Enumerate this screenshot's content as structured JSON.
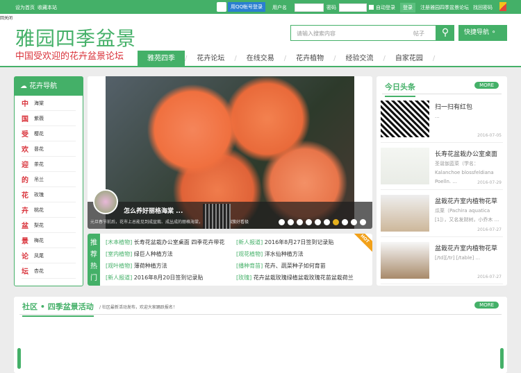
{
  "topbar": {
    "set_home": "设为首页",
    "bookmark": "收藏本站",
    "qq_login": "用QQ帐号登录",
    "username_label": "用户名",
    "password_label": "密码",
    "auto_login": "自动登录",
    "login": "登录",
    "register": "注册雅园四季盆景论坛",
    "forgot": "找回密码"
  },
  "close_label": "回关闭",
  "header": {
    "logo": "雅园四季盆景",
    "slogan": "中国受欢迎的花卉盆景论坛",
    "search_placeholder": "请输入搜索内容",
    "search_type": "帖子",
    "quick_nav": "快捷导航"
  },
  "nav": [
    "雅苑四季",
    "花卉论坛",
    "在线交易",
    "花卉植物",
    "经验交流",
    "自家花园"
  ],
  "flower_nav": {
    "title": "花卉导航",
    "items": [
      {
        "c": "中",
        "n": "海棠"
      },
      {
        "c": "国",
        "n": "紫薇"
      },
      {
        "c": "受",
        "n": "樱花"
      },
      {
        "c": "欢",
        "n": "昙花"
      },
      {
        "c": "迎",
        "n": "茶花"
      },
      {
        "c": "的",
        "n": "吊兰"
      },
      {
        "c": "花",
        "n": "玫瑰"
      },
      {
        "c": "卉",
        "n": "桃花"
      },
      {
        "c": "盆",
        "n": "梨花"
      },
      {
        "c": "景",
        "n": "梅花"
      },
      {
        "c": "论",
        "n": "凤尾"
      },
      {
        "c": "坛",
        "n": "杏花"
      }
    ]
  },
  "slider": {
    "title": "怎么养好丽格海棠 ...",
    "desc": "元旦春节前后，花市上总能见到成盆栽、成丛成的丽格海棠，一盆盆的花团锦簇好看极",
    "active_dot": 6,
    "dot_count": 10
  },
  "recommend": {
    "tag": "推荐热门",
    "items": [
      {
        "cat": "[木本植物]",
        "t": "长寿花盆栽办公室桌面 四季花卉带花"
      },
      {
        "cat": "[新人报道]",
        "t": "2016年8月27日签到记录贴"
      },
      {
        "cat": "[室内植物]",
        "t": "绿巨人种植方法"
      },
      {
        "cat": "[观花植物]",
        "t": "洋水仙种植方法"
      },
      {
        "cat": "[观叶植物]",
        "t": "薄荷种植方法"
      },
      {
        "cat": "[播种育苗]",
        "t": "花卉、蔬菜种子如何育苗"
      },
      {
        "cat": "[新人报道]",
        "t": "2016年8月20日签到记录贴"
      },
      {
        "cat": "[玫瑰]",
        "t": "花卉盆栽玫瑰绿植盆栽玫瑰花苗盆栽荷兰"
      }
    ],
    "hot": "HOT"
  },
  "headlines": {
    "title": "今日头条",
    "more": "MORE",
    "items": [
      {
        "t": "扫一扫有红包",
        "d": "...",
        "date": "2016-07-05"
      },
      {
        "t": "长寿花盆栽办公室桌面",
        "d": "圣诞伽蓝菜（学名：Kalanchoe blossfeldiana Poelln. ...",
        "date": "2016-07-29"
      },
      {
        "t": "盆栽花卉室内植物花草",
        "d": "瓜栗（Pachira aquatica [1]），又名发财树，小乔木 ...",
        "date": "2016-07-27"
      },
      {
        "t": "盆栽花卉室内植物花草",
        "d": "[/td][/tr] [/table] ...",
        "date": "2016-07-27"
      }
    ]
  },
  "community": {
    "title": "社区 • 四季盆景活动",
    "subtitle": "/ 社区最新活动发布，欢迎大家踊跃报名！",
    "more": "MORE"
  }
}
